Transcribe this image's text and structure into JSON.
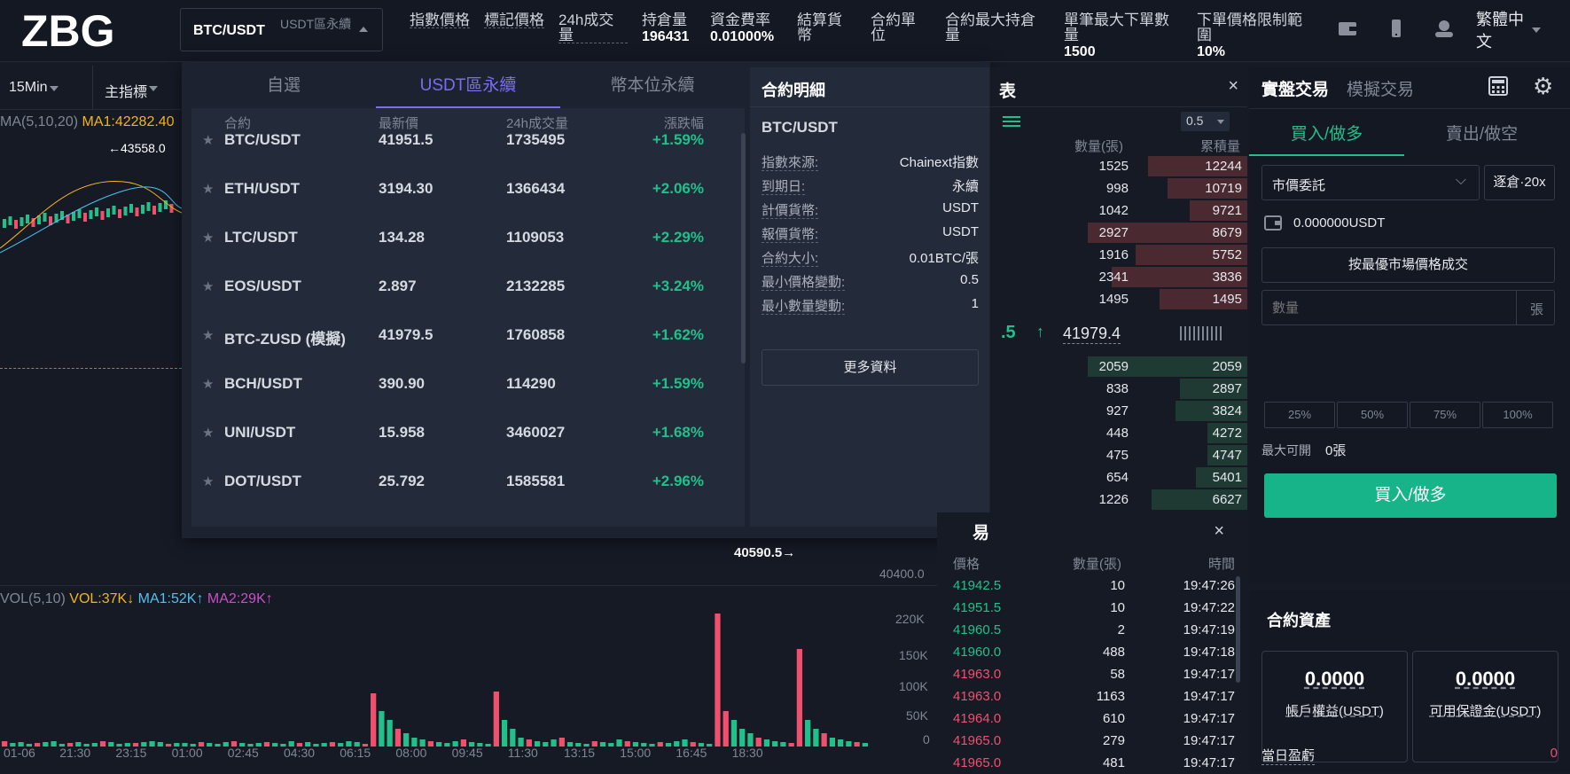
{
  "topbar": {
    "logo": "ZBG",
    "pair": "BTC/USDT",
    "pair_sub": "USDT區永續",
    "stats": [
      {
        "label": "指數價格",
        "value": ""
      },
      {
        "label": "標記價格",
        "value": ""
      },
      {
        "label": "24h成交量",
        "value": ""
      },
      {
        "label": "持倉量",
        "value": "196431"
      },
      {
        "label": "資金費率",
        "value": "0.01000%"
      },
      {
        "label": "結算貨幣",
        "value": ""
      },
      {
        "label": "合約單位",
        "value": ""
      },
      {
        "label": "合約最大持倉量",
        "value": ""
      },
      {
        "label": "單筆最大下單數量",
        "value": "1500"
      },
      {
        "label": "下單價格限制範圍",
        "value": "10%"
      }
    ],
    "language": "繁體中文"
  },
  "chart": {
    "interval": "15Min",
    "indicator": "主指標",
    "ma_label": "MA(5,10,20)",
    "ma1": "MA1:42282.40",
    "high_label": "←43558.0",
    "low_label": "40590.5→",
    "price_tick": "40400.0",
    "vol_label": "VOL(5,10)",
    "vol": "VOL:37K↓",
    "vma1": "MA1:52K↑",
    "vma2": "MA2:29K↑",
    "vol_ticks": [
      "220K",
      "150K",
      "100K",
      "50K",
      "0"
    ],
    "time_ticks": [
      "01-06",
      "21:30",
      "23:15",
      "01:00",
      "02:45",
      "04:30",
      "06:15",
      "08:00",
      "09:45",
      "11:30",
      "13:15",
      "15:00",
      "16:45",
      "18:30"
    ]
  },
  "market": {
    "tabs": [
      "自選",
      "USDT區永續",
      "幣本位永續"
    ],
    "headers": [
      "合約",
      "最新價",
      "24h成交量",
      "漲跌幅"
    ],
    "rows": [
      {
        "name": "BTC/USDT",
        "price": "41951.5",
        "vol": "1735495",
        "change": "+1.59%"
      },
      {
        "name": "ETH/USDT",
        "price": "3194.30",
        "vol": "1366434",
        "change": "+2.06%"
      },
      {
        "name": "LTC/USDT",
        "price": "134.28",
        "vol": "1109053",
        "change": "+2.29%"
      },
      {
        "name": "EOS/USDT",
        "price": "2.897",
        "vol": "2132285",
        "change": "+3.24%"
      },
      {
        "name": "BTC-ZUSD (模擬)",
        "price": "41979.5",
        "vol": "1760858",
        "change": "+1.62%"
      },
      {
        "name": "BCH/USDT",
        "price": "390.90",
        "vol": "114290",
        "change": "+1.59%"
      },
      {
        "name": "UNI/USDT",
        "price": "15.958",
        "vol": "3460027",
        "change": "+1.68%"
      },
      {
        "name": "DOT/USDT",
        "price": "25.792",
        "vol": "1585581",
        "change": "+2.96%"
      }
    ]
  },
  "detail": {
    "title": "合約明細",
    "pair": "BTC/USDT",
    "rows": [
      {
        "k": "指數來源:",
        "v": "Chainext指數"
      },
      {
        "k": "到期日:",
        "v": "永續"
      },
      {
        "k": "計價貨幣:",
        "v": "USDT"
      },
      {
        "k": "報價貨幣:",
        "v": "USDT"
      },
      {
        "k": "合約大小:",
        "v": "0.01BTC/張"
      },
      {
        "k": "最小價格變動:",
        "v": "0.5"
      },
      {
        "k": "最小數量變動:",
        "v": "1"
      }
    ],
    "more": "更多資料"
  },
  "orderbook": {
    "title": "表",
    "depth": "0.5",
    "qty_header": "數量(張)",
    "total_header": "累積量",
    "asks": [
      {
        "q": "1525",
        "t": "12244",
        "f": 0.62
      },
      {
        "q": "998",
        "t": "10719",
        "f": 0.5
      },
      {
        "q": "1042",
        "t": "9721",
        "f": 0.36
      },
      {
        "q": "2927",
        "t": "8679",
        "f": 1.0
      },
      {
        "q": "1916",
        "t": "5752",
        "f": 0.7
      },
      {
        "q": "2341",
        "t": "3836",
        "f": 0.85
      },
      {
        "q": "1495",
        "t": "1495",
        "f": 0.55
      }
    ],
    "last_price_left": ".5",
    "last_price": "41979.4",
    "bids": [
      {
        "q": "2059",
        "t": "2059",
        "f": 1.0
      },
      {
        "q": "838",
        "t": "2897",
        "f": 0.42
      },
      {
        "q": "927",
        "t": "3824",
        "f": 0.45
      },
      {
        "q": "448",
        "t": "4272",
        "f": 0.25
      },
      {
        "q": "475",
        "t": "4747",
        "f": 0.25
      },
      {
        "q": "654",
        "t": "5401",
        "f": 0.32
      },
      {
        "q": "1226",
        "t": "6627",
        "f": 0.6
      }
    ]
  },
  "trades": {
    "title": "易",
    "headers": [
      "價格",
      "數量(張)",
      "時間"
    ],
    "rows": [
      {
        "p": "41942.5",
        "q": "10",
        "t": "19:47:26",
        "side": "buy"
      },
      {
        "p": "41951.5",
        "q": "10",
        "t": "19:47:22",
        "side": "buy"
      },
      {
        "p": "41960.5",
        "q": "2",
        "t": "19:47:19",
        "side": "buy"
      },
      {
        "p": "41960.0",
        "q": "488",
        "t": "19:47:18",
        "side": "buy"
      },
      {
        "p": "41963.0",
        "q": "58",
        "t": "19:47:17",
        "side": "sell"
      },
      {
        "p": "41963.0",
        "q": "1163",
        "t": "19:47:17",
        "side": "sell"
      },
      {
        "p": "41964.0",
        "q": "610",
        "t": "19:47:17",
        "side": "sell"
      },
      {
        "p": "41965.0",
        "q": "279",
        "t": "19:47:17",
        "side": "sell"
      },
      {
        "p": "41965.0",
        "q": "481",
        "t": "19:47:17",
        "side": "sell"
      }
    ]
  },
  "trade_panel": {
    "tab_real": "實盤交易",
    "tab_sim": "模擬交易",
    "buy_tab": "買入/做多",
    "sell_tab": "賣出/做空",
    "order_type": "市價委託",
    "leverage": "逐倉·20x",
    "balance": "0.000000USDT",
    "market_price": "按最優市場價格成交",
    "qty_placeholder": "數量",
    "qty_unit": "張",
    "pcts": [
      "25%",
      "50%",
      "75%",
      "100%"
    ],
    "max_label": "最大可開",
    "max_value": "0張",
    "buy_button": "買入/做多"
  },
  "assets": {
    "title": "合約資產",
    "equity": "0.0000",
    "equity_label": "帳戶權益(USDT)",
    "margin": "0.0000",
    "margin_label": "可用保證金(USDT)",
    "pnl_label": "當日盈虧",
    "pnl_value": "0"
  },
  "colors": {
    "accent": "#7b6cf0",
    "buy": "#21c08a",
    "sell": "#f0506e",
    "buybtn": "#17b48a"
  }
}
